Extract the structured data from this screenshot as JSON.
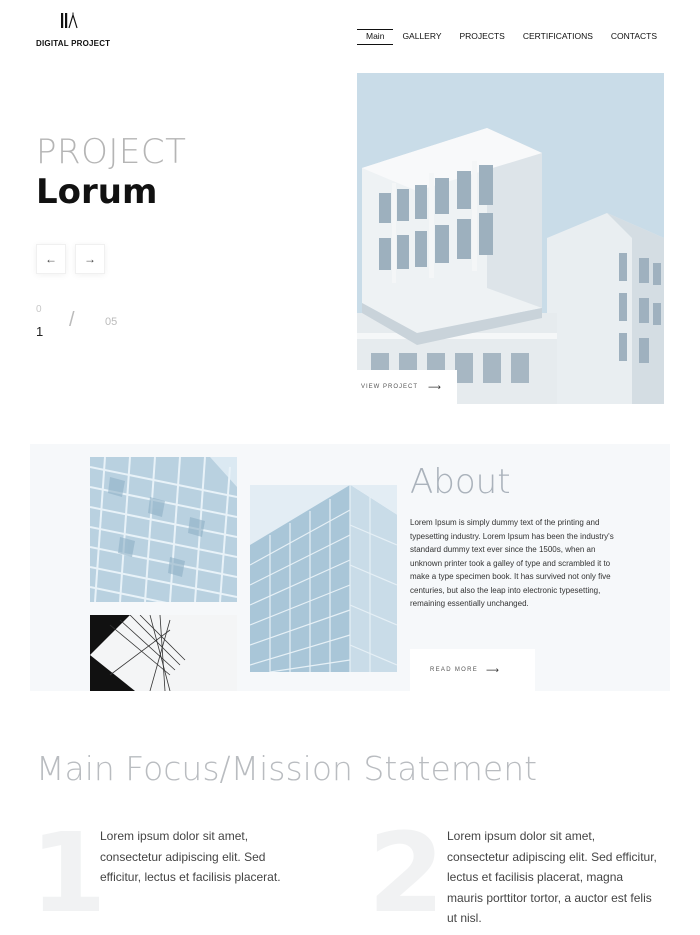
{
  "header": {
    "logo_text": "DIGITAL PROJECT",
    "nav": [
      "Main",
      "GALLERY",
      "PROJECTS",
      "CERTIFICATIONS",
      "CONTACTS"
    ],
    "active_nav": "Main"
  },
  "hero": {
    "pre_title": "PROJECT",
    "title": "Lorum",
    "prev_arrow": "←",
    "next_arrow": "→",
    "counter": {
      "previous": "0",
      "current": "1",
      "separator": "/",
      "total": "05"
    },
    "view_project_label": "VIEW PROJECT",
    "view_project_arrow": "⟶"
  },
  "about": {
    "heading": "About",
    "body": "Lorem Ipsum is simply dummy text of the printing and typesetting industry. Lorem Ipsum has been the industry's standard dummy text ever since the 1500s, when an unknown printer took a galley of type and scrambled it to make a type specimen book. It has survived not only five centuries, but also the leap into electronic typesetting, remaining essentially unchanged.",
    "read_more_label": "READ MORE",
    "read_more_arrow": "⟶"
  },
  "mission": {
    "title": "Main Focus/Mission Statement",
    "items": [
      {
        "number": "1",
        "text": "Lorem ipsum dolor sit amet, consectetur adipiscing elit. Sed efficitur, lectus et facilisis placerat."
      },
      {
        "number": "2",
        "text": "Lorem ipsum dolor sit amet, consectetur adipiscing elit. Sed efficitur, lectus et facilisis placerat, magna mauris porttitor tortor, a auctor est felis ut nisl."
      }
    ]
  },
  "colors": {
    "sky": "#c9dce8",
    "about_bg": "#f6f8fa",
    "heading_gray": "#b5b5b5"
  }
}
